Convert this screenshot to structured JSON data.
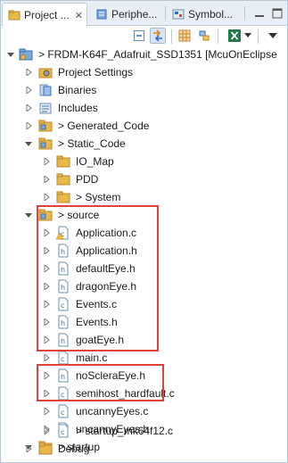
{
  "tabs": [
    {
      "label": "Project ...",
      "close": "✕"
    },
    {
      "label": "Periphe...",
      "close": ""
    },
    {
      "label": "Symbol...",
      "close": ""
    }
  ],
  "toolbar": {
    "buttons": [
      "collapse-all-icon",
      "link-with-editor-icon",
      "filter-icon",
      "sync-icon",
      "excel-icon",
      "view-menu-icon"
    ]
  },
  "tree": {
    "project": "> FRDM-K64F_Adafruit_SSD1351 [McuOnEclipse",
    "items": [
      {
        "label": "Project Settings"
      },
      {
        "label": "Binaries"
      },
      {
        "label": "Includes"
      },
      {
        "label": "> Generated_Code"
      },
      {
        "label": "> Static_Code"
      },
      {
        "label": "IO_Map"
      },
      {
        "label": "PDD"
      },
      {
        "label": "> System"
      },
      {
        "label": "> source"
      },
      {
        "label": "Application.c"
      },
      {
        "label": "Application.h"
      },
      {
        "label": "defaultEye.h"
      },
      {
        "label": "dragonEye.h"
      },
      {
        "label": "Events.c"
      },
      {
        "label": "Events.h"
      },
      {
        "label": "goatEye.h"
      },
      {
        "label": "main.c"
      },
      {
        "label": "noScleraEye.h"
      },
      {
        "label": "semihost_hardfault.c"
      },
      {
        "label": "uncannyEyes.c"
      },
      {
        "label": "uncannyEyes.h"
      },
      {
        "label": "> startup"
      },
      {
        "label": "> startup_mk64f12.c"
      },
      {
        "label": "Debug"
      }
    ]
  },
  "colors": {
    "highlight": "#e2403a",
    "folder": "#e8b94a",
    "accent": "#3a6fb5"
  }
}
